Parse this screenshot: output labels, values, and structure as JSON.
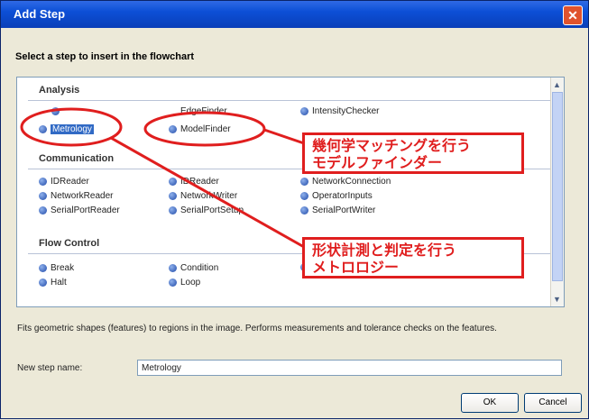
{
  "window": {
    "title": "Add Step"
  },
  "prompt": "Select a step to insert in the flowchart",
  "categories": [
    {
      "label": "Analysis"
    },
    {
      "label": "Communication"
    },
    {
      "label": "Flow Control"
    }
  ],
  "items": {
    "edge_finder": "EdgeFinder",
    "intensity_checker": "IntensityChecker",
    "metrology": "Metrology",
    "model_finder": "ModelFinder",
    "id_reader": "IDReader",
    "id_reader2": "IDReader",
    "network_connection": "NetworkConnection",
    "network_reader": "NetworkReader",
    "network_writer": "NetworkWriter",
    "operator_inputs": "OperatorInputs",
    "serial_port_reader": "SerialPortReader",
    "serial_port_setup": "SerialPortSetup",
    "serial_port_writer": "SerialPortWriter",
    "break": "Break",
    "condition": "Condition",
    "halt": "Halt",
    "loop": "Loop"
  },
  "annotations": {
    "model_finder_note_1": "幾何学マッチングを行う",
    "model_finder_note_2": "モデルファインダー",
    "metrology_note_1": "形状計測と判定を行う",
    "metrology_note_2": "メトロロジー"
  },
  "description": "Fits geometric shapes (features) to regions in the image. Performs measurements and tolerance checks on the features.",
  "step_name": {
    "label": "New step name:",
    "value": "Metrology"
  },
  "buttons": {
    "ok": "OK",
    "cancel": "Cancel"
  },
  "colors": {
    "titlebar": "#0c4fd6",
    "annotation": "#e01e1e",
    "selection": "#316ac5"
  }
}
